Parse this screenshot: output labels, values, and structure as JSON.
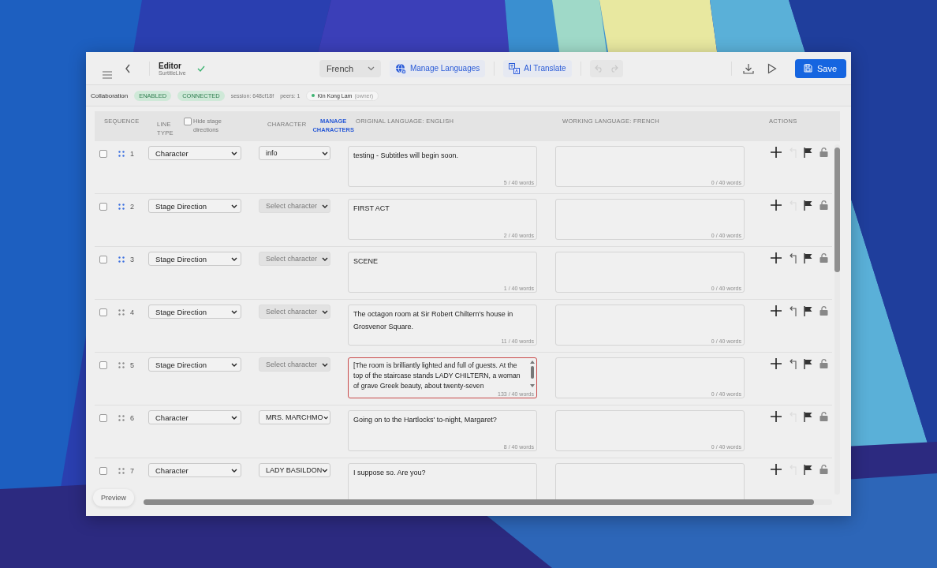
{
  "toolbar": {
    "title": "Editor",
    "subtitle": "SurtitleLive",
    "saved": true,
    "language": "French",
    "manage_languages": "Manage Languages",
    "ai_translate": "AI Translate",
    "undo_enabled": false,
    "redo_enabled": false,
    "save": "Save"
  },
  "collaboration": {
    "label": "Collaboration",
    "badges": [
      "ENABLED",
      "CONNECTED"
    ],
    "session": "session: 648cf18f",
    "peers": "peers: 1",
    "user": {
      "name": "Kin Kong Lam",
      "role": "(owner)",
      "online": true
    }
  },
  "table": {
    "columns": {
      "sequence": "SEQUENCE",
      "line_type": "LINE TYPE",
      "hide_stage_directions": {
        "label": "Hide stage directions",
        "checked": false
      },
      "character": "CHARACTER",
      "manage_characters": "MANAGE CHARACTERS",
      "original": "ORIGINAL LANGUAGE: ENGLISH",
      "working": "WORKING LANGUAGE: FRENCH",
      "actions": "ACTIONS"
    },
    "rows": [
      {
        "number": "1",
        "checked": false,
        "drag_highlight": true,
        "line_type": "Character",
        "character": {
          "value": "info"
        },
        "original": "testing - Subtitles will begin soon.",
        "original_count": "5 / 40 words",
        "over_limit": false,
        "working_count": "0 / 40 words",
        "revert_enabled": false
      },
      {
        "number": "2",
        "checked": false,
        "drag_highlight": true,
        "line_type": "Stage Direction",
        "character": {
          "placeholder": "Select character"
        },
        "original": "FIRST ACT",
        "original_count": "2 / 40 words",
        "over_limit": false,
        "working_count": "0 / 40 words",
        "revert_enabled": false
      },
      {
        "number": "3",
        "checked": false,
        "drag_highlight": true,
        "line_type": "Stage Direction",
        "character": {
          "placeholder": "Select character"
        },
        "original": "SCENE",
        "original_count": "1 / 40 words",
        "over_limit": false,
        "working_count": "0 / 40 words",
        "revert_enabled": true
      },
      {
        "number": "4",
        "checked": false,
        "drag_highlight": false,
        "line_type": "Stage Direction",
        "character": {
          "placeholder": "Select character"
        },
        "original": "The octagon room at Sir Robert Chiltern's house in Grosvenor Square.",
        "original_count": "11 / 40 words",
        "over_limit": false,
        "working_count": "0 / 40 words",
        "revert_enabled": true
      },
      {
        "number": "5",
        "checked": false,
        "drag_highlight": false,
        "line_type": "Stage Direction",
        "character": {
          "placeholder": "Select character"
        },
        "original": "[The room is brilliantly lighted and full of guests. At the top of the staircase stands LADY CHILTERN, a woman of grave Greek beauty, about twenty-seven",
        "original_count": "133 / 40 words",
        "over_limit": true,
        "working_count": "0 / 40 words",
        "revert_enabled": true
      },
      {
        "number": "6",
        "checked": false,
        "drag_highlight": false,
        "line_type": "Character",
        "character": {
          "value": "MRS. MARCHMO"
        },
        "original": "Going on to the Hartlocks' to-night, Margaret?",
        "original_count": "8 / 40 words",
        "over_limit": false,
        "working_count": "0 / 40 words",
        "revert_enabled": false
      },
      {
        "number": "7",
        "checked": false,
        "drag_highlight": false,
        "line_type": "Character",
        "character": {
          "value": "LADY BASILDON"
        },
        "original": "I suppose so. Are you?",
        "revert_enabled": false
      }
    ]
  },
  "preview": "Preview"
}
